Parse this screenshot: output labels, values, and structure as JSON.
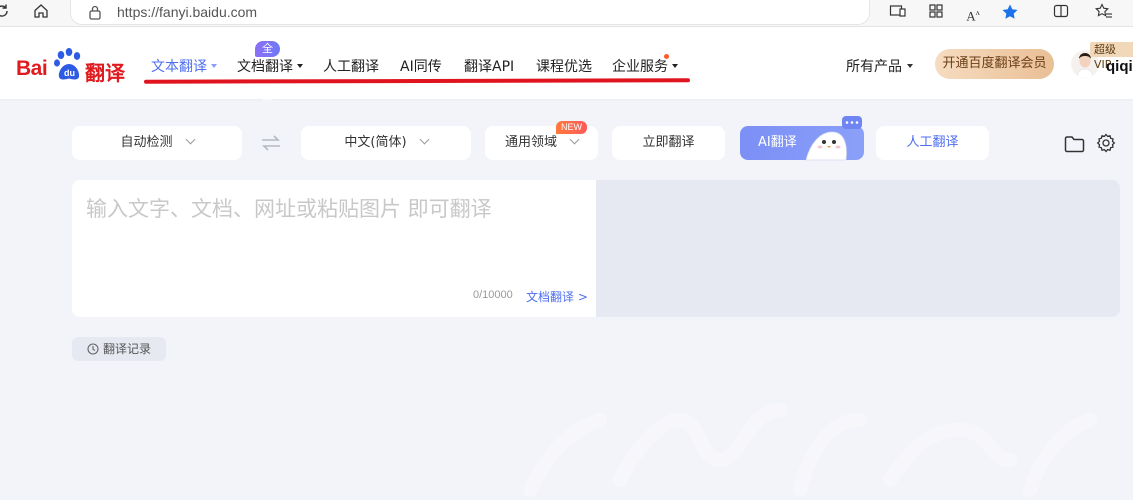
{
  "browser": {
    "url": "https://fanyi.baidu.com",
    "icons": [
      "refresh-icon",
      "home-icon",
      "lock-icon",
      "reader-mode-icon",
      "apps-icon",
      "read-aloud-icon",
      "favorite-star-icon",
      "split-screen-icon",
      "favorites-icon"
    ]
  },
  "logo": {
    "part1": "Bai",
    "part2": "翻译"
  },
  "nav": {
    "items": [
      {
        "label": "文本翻译",
        "active": true,
        "dropdown": true
      },
      {
        "label": "文档翻译",
        "active": false,
        "dropdown": true,
        "badge": "全新升级"
      },
      {
        "label": "人工翻译",
        "active": false
      },
      {
        "label": "AI同传",
        "active": false
      },
      {
        "label": "翻译API",
        "active": false
      },
      {
        "label": "课程优选",
        "active": false
      },
      {
        "label": "企业服务",
        "active": false,
        "dropdown": true,
        "hot_dot": true
      }
    ],
    "all_products": "所有产品",
    "vip_button": "开通百度翻译会员",
    "vip_badge": "超级VIP",
    "username": "qiqi"
  },
  "toolbar": {
    "source_lang": "自动检测",
    "target_lang": "中文(简体)",
    "domain": "通用领域",
    "domain_badge": "NEW",
    "translate_now": "立即翻译",
    "ai_translate": "AI翻译",
    "human_translate": "人工翻译"
  },
  "input": {
    "placeholder": "输入文字、文档、网址或粘贴图片 即可翻译",
    "counter": "0/10000",
    "doc_link": "文档翻译 >"
  },
  "history": {
    "label": "翻译记录"
  },
  "colors": {
    "brand_red": "#e01b1f",
    "accent_blue": "#4e6ef2",
    "page_bg": "#f3f4f9",
    "annotation_red": "#e0141f"
  }
}
